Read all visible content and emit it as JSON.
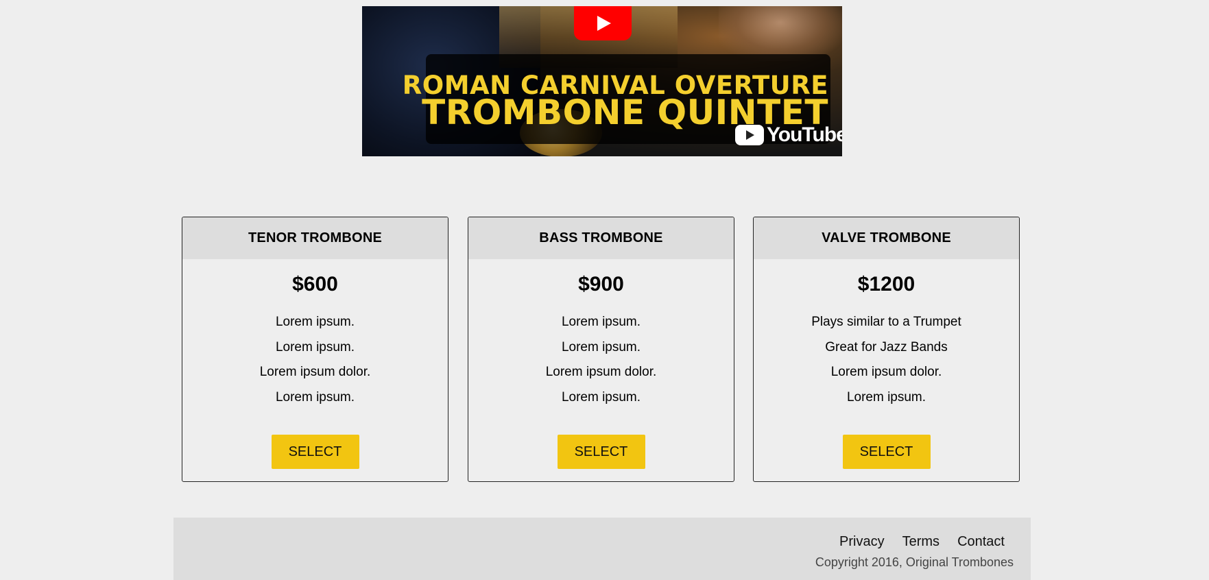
{
  "video": {
    "title_line1": "ROMAN CARNIVAL OVERTURE",
    "title_line2": "TROMBONE QUINTET",
    "platform": "YouTube",
    "play_icon": "play-icon",
    "colors": {
      "title": "#f4cf2e",
      "play": "#ff0000"
    }
  },
  "plans": [
    {
      "name": "TENOR TROMBONE",
      "price": "$600",
      "features": [
        "Lorem ipsum.",
        "Lorem ipsum.",
        "Lorem ipsum dolor.",
        "Lorem ipsum."
      ],
      "button": "SELECT"
    },
    {
      "name": "BASS TROMBONE",
      "price": "$900",
      "features": [
        "Lorem ipsum.",
        "Lorem ipsum.",
        "Lorem ipsum dolor.",
        "Lorem ipsum."
      ],
      "button": "SELECT"
    },
    {
      "name": "VALVE TROMBONE",
      "price": "$1200",
      "features": [
        "Plays similar to a Trumpet",
        "Great for Jazz Bands",
        "Lorem ipsum dolor.",
        "Lorem ipsum."
      ],
      "button": "SELECT"
    }
  ],
  "footer": {
    "links": [
      "Privacy",
      "Terms",
      "Contact"
    ],
    "copyright": "Copyright 2016, Original Trombones"
  },
  "colors": {
    "accent": "#f2c511",
    "background": "#eeeeee",
    "panel": "#dddddd"
  }
}
